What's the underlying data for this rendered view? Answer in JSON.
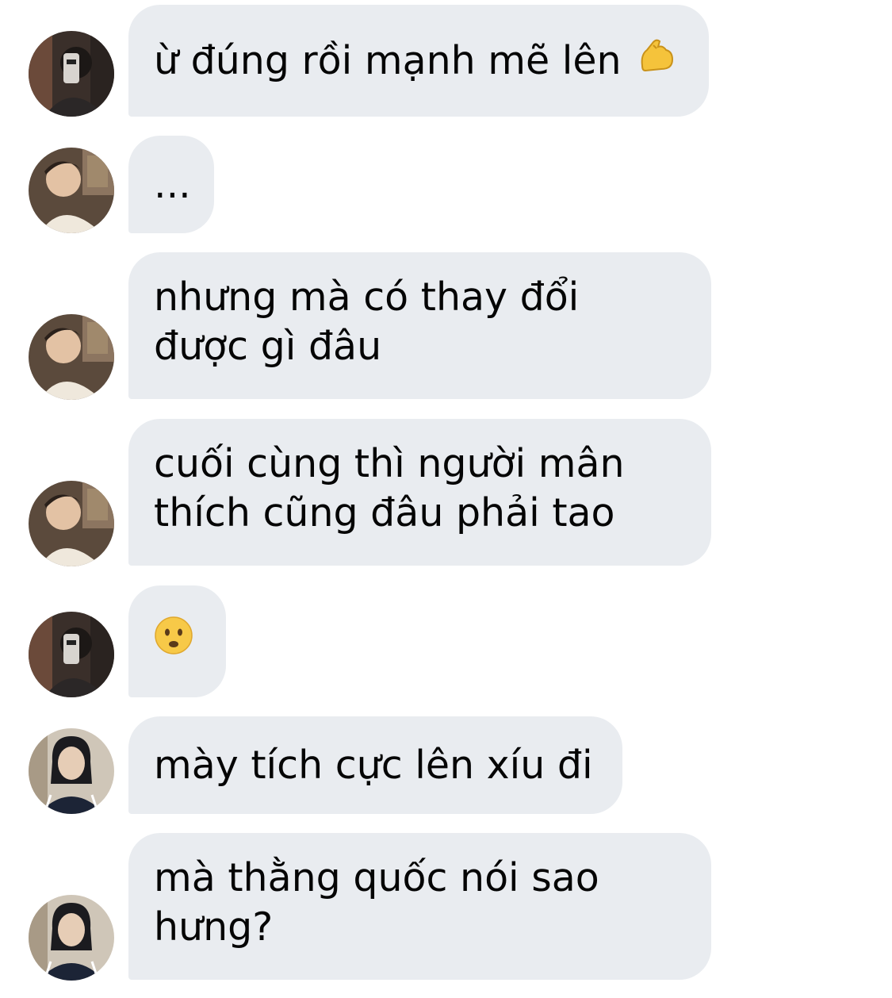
{
  "messages": [
    {
      "sender": "friend-a",
      "avatar": "mirror-selfie-avatar",
      "lines": [
        "ừ đúng rồi mạnh mẽ lên"
      ],
      "emoji": "flexed-biceps-icon"
    },
    {
      "sender": "friend-b",
      "avatar": "winking-portrait-avatar",
      "lines": [
        "..."
      ]
    },
    {
      "sender": "friend-b",
      "avatar": "winking-portrait-avatar",
      "lines": [
        "nhưng mà có thay đổi",
        "được gì đâu"
      ]
    },
    {
      "sender": "friend-b",
      "avatar": "winking-portrait-avatar",
      "lines": [
        "cuối cùng thì người mân",
        "thích cũng đâu phải tao"
      ]
    },
    {
      "sender": "friend-a",
      "avatar": "mirror-selfie-avatar",
      "lines": [],
      "emoji": "frowning-face-icon"
    },
    {
      "sender": "friend-c",
      "avatar": "track-jacket-avatar",
      "lines": [
        "mày tích cực lên xíu đi"
      ]
    },
    {
      "sender": "friend-c",
      "avatar": "track-jacket-avatar",
      "lines": [
        "mà thằng quốc nói sao",
        "hưng?"
      ]
    }
  ],
  "colors": {
    "bubble_bg": "#e9ecf0",
    "text": "#050505",
    "background": "#ffffff"
  }
}
